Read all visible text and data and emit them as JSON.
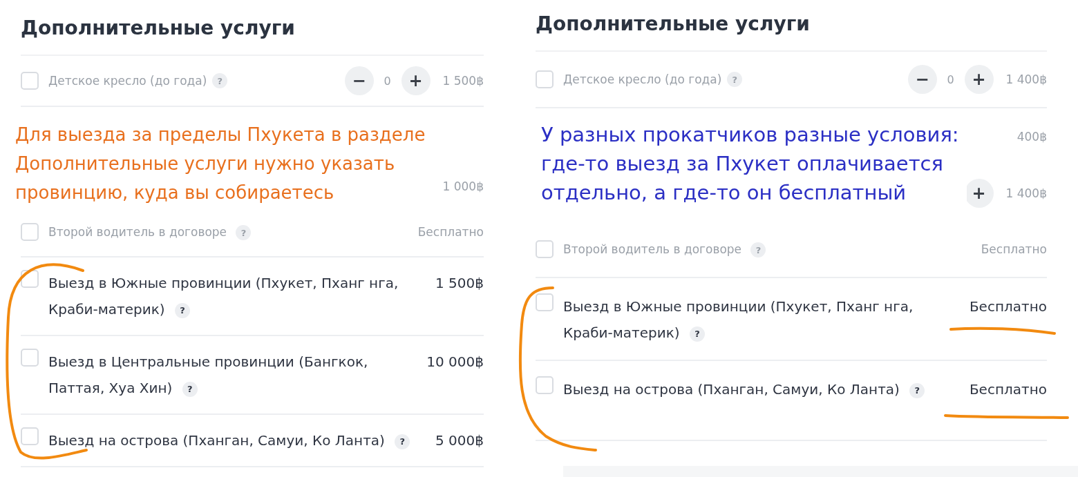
{
  "panels": [
    {
      "title": "Дополнительные услуги",
      "annotation": {
        "text": "Для выезда за пределы Пхукета в разделе Дополнительные услуги нужно указать провинцию, куда вы собираетесь",
        "color": "#e8701e"
      },
      "rows": [
        {
          "kind": "stepper",
          "blurred": true,
          "checked": false,
          "label": "Детское кресло (до года)",
          "help": "?",
          "minus": "−",
          "count": "0",
          "plus": "+",
          "price": "1 500฿"
        },
        {
          "kind": "partial",
          "price": "1 000฿"
        },
        {
          "kind": "option",
          "blurred": true,
          "checked": false,
          "label": "Второй водитель в договоре",
          "help": "?",
          "price": "Бесплатно"
        },
        {
          "kind": "option",
          "blurred": false,
          "checked": false,
          "label": "Выезд в Южные провинции (Пхукет, Пханг нга, Краби-материк)",
          "help": "?",
          "price": "1 500฿"
        },
        {
          "kind": "option",
          "blurred": false,
          "checked": false,
          "label": "Выезд в Центральные провинции (Бангкок, Паттая, Хуа Хин)",
          "help": "?",
          "price": "10 000฿"
        },
        {
          "kind": "option",
          "blurred": false,
          "checked": false,
          "label": "Выезд на острова (Пханган, Самуи, Ко Ланта)",
          "help": "?",
          "price": "5 000฿"
        }
      ]
    },
    {
      "title": "Дополнительные услуги",
      "annotation": {
        "text": "У разных прокатчиков разные условия: где-то выезд за Пхукет оплачивается отдельно, а где-то он бесплатный",
        "color": "#2b2fc4"
      },
      "rows": [
        {
          "kind": "stepper",
          "blurred": true,
          "checked": false,
          "label": "Детское кресло (до года)",
          "help": "?",
          "minus": "−",
          "count": "0",
          "plus": "+",
          "price": "1 400฿"
        },
        {
          "kind": "partial",
          "price": "400฿"
        },
        {
          "kind": "partial",
          "plus": "+",
          "price": "1 400฿"
        },
        {
          "kind": "option",
          "blurred": true,
          "checked": false,
          "label": "Второй водитель в договоре",
          "help": "?",
          "price": "Бесплатно"
        },
        {
          "kind": "option",
          "blurred": false,
          "checked": false,
          "label": "Выезд в Южные провинции (Пхукет, Пханг нга, Краби-материк)",
          "help": "?",
          "price": "Бесплатно"
        },
        {
          "kind": "option",
          "blurred": false,
          "checked": false,
          "label": "Выезд на острова (Пханган, Самуи, Ко Ланта)",
          "help": "?",
          "price": "Бесплатно"
        }
      ]
    }
  ]
}
